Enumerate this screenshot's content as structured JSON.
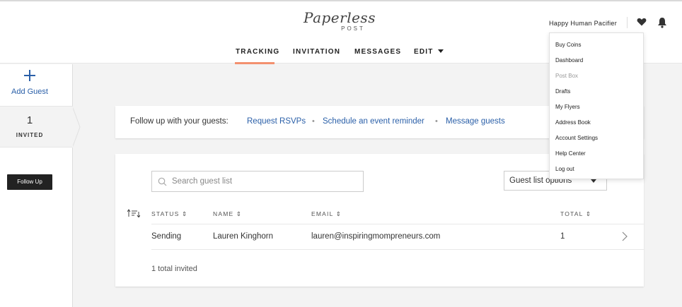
{
  "header": {
    "logo_main": "Paperless",
    "logo_sub": "POST",
    "nav": {
      "tracking": "TRACKING",
      "invitation": "INVITATION",
      "messages": "MESSAGES",
      "edit": "EDIT"
    },
    "user_name": "Happy Human Pacifier",
    "icons": [
      "heart-icon",
      "bell-icon"
    ]
  },
  "sidebar": {
    "add_guest": "Add Guest",
    "invited_count": "1",
    "invited_label": "INVITED",
    "follow_up": "Follow Up"
  },
  "follow_up_bar": {
    "label": "Follow up with your guests:",
    "links": [
      "Request RSVPs",
      "Schedule an event reminder",
      "Message guests"
    ],
    "separator": "•"
  },
  "guest_table": {
    "search_placeholder": "Search guest list",
    "options_label": "Guest list options",
    "columns": {
      "status": "STATUS ⇕",
      "name": "NAME ⇕",
      "email": "EMAIL ⇕",
      "total": "TOTAL ⇕"
    },
    "rows": [
      {
        "status": "Sending",
        "name": "Lauren Kinghorn",
        "email": "lauren@inspiringmompreneurs.com",
        "total": "1"
      }
    ],
    "footer": "1 total invited"
  },
  "account_menu": {
    "items": [
      "Buy Coins",
      "Dashboard",
      "Post Box",
      "Drafts",
      "My Flyers",
      "Address Book",
      "Account Settings",
      "Help Center",
      "Log out"
    ]
  },
  "colors": {
    "link": "#2a5fa8",
    "accent_underline": "#f3906f",
    "button_dark": "#222222"
  }
}
